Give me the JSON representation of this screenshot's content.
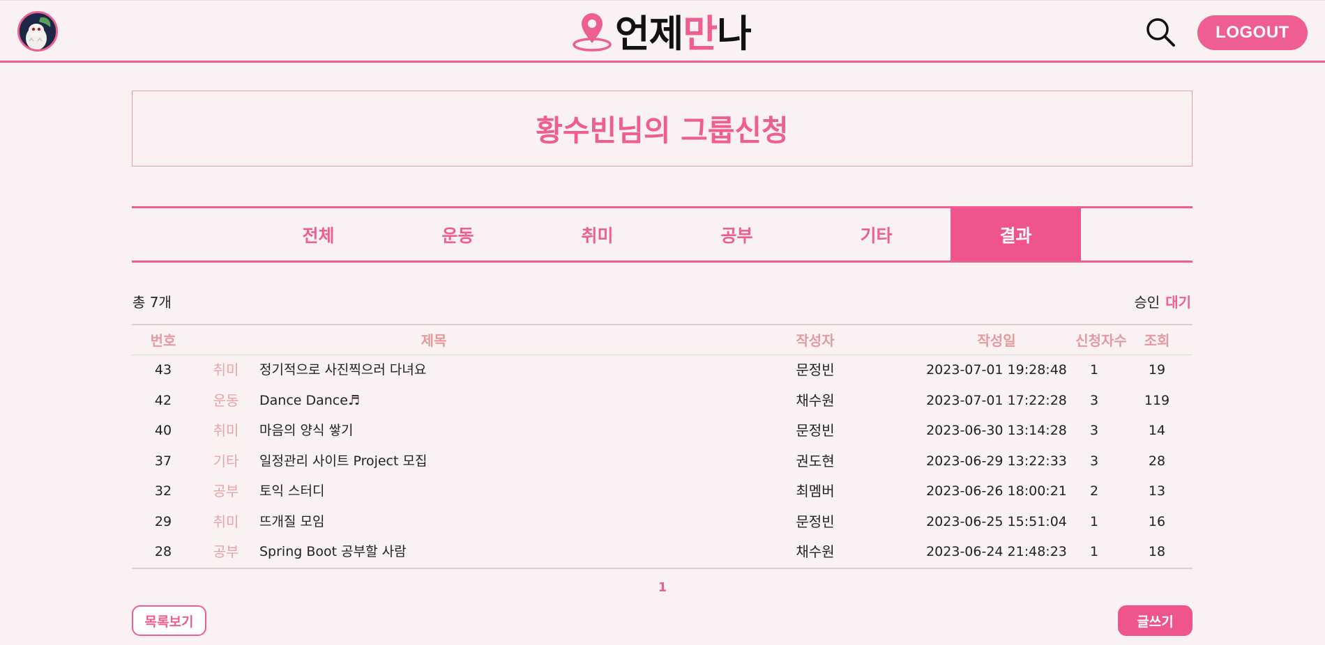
{
  "header": {
    "logo_part1": "언제",
    "logo_part2": "만",
    "logo_part3": "나",
    "logout_label": "LOGOUT"
  },
  "page_title": "황수빈님의 그룹신청",
  "tabs": [
    {
      "label": "전체",
      "active": false
    },
    {
      "label": "운동",
      "active": false
    },
    {
      "label": "취미",
      "active": false
    },
    {
      "label": "공부",
      "active": false
    },
    {
      "label": "기타",
      "active": false
    },
    {
      "label": "결과",
      "active": true
    }
  ],
  "summary": {
    "total": "총 7개",
    "filter_approved": "승인",
    "filter_waiting": "대기"
  },
  "table": {
    "headers": {
      "no": "번호",
      "title": "제목",
      "author": "작성자",
      "date": "작성일",
      "applicants": "신청자수",
      "views": "조회"
    },
    "rows": [
      {
        "no": "43",
        "category": "취미",
        "title": "정기적으로 사진찍으러 다녀요",
        "author": "문정빈",
        "date": "2023-07-01 19:28:48",
        "applicants": "1",
        "views": "19"
      },
      {
        "no": "42",
        "category": "운동",
        "title": "Dance Dance♬",
        "author": "채수원",
        "date": "2023-07-01 17:22:28",
        "applicants": "3",
        "views": "119"
      },
      {
        "no": "40",
        "category": "취미",
        "title": "마음의 양식 쌓기",
        "author": "문정빈",
        "date": "2023-06-30 13:14:28",
        "applicants": "3",
        "views": "14"
      },
      {
        "no": "37",
        "category": "기타",
        "title": "일정관리 사이트 Project 모집",
        "author": "권도현",
        "date": "2023-06-29 13:22:33",
        "applicants": "3",
        "views": "28"
      },
      {
        "no": "32",
        "category": "공부",
        "title": "토익 스터디",
        "author": "최멤버",
        "date": "2023-06-26 18:00:21",
        "applicants": "2",
        "views": "13"
      },
      {
        "no": "29",
        "category": "취미",
        "title": "뜨개질 모임",
        "author": "문정빈",
        "date": "2023-06-25 15:51:04",
        "applicants": "1",
        "views": "16"
      },
      {
        "no": "28",
        "category": "공부",
        "title": "Spring Boot 공부할 사람",
        "author": "채수원",
        "date": "2023-06-24 21:48:23",
        "applicants": "1",
        "views": "18"
      }
    ]
  },
  "pagination": {
    "current": "1"
  },
  "buttons": {
    "list": "목록보기",
    "write": "글쓰기"
  },
  "colors": {
    "accent": "#ee5e93",
    "background": "#f9f1f2",
    "category": "#e8a4a7"
  }
}
